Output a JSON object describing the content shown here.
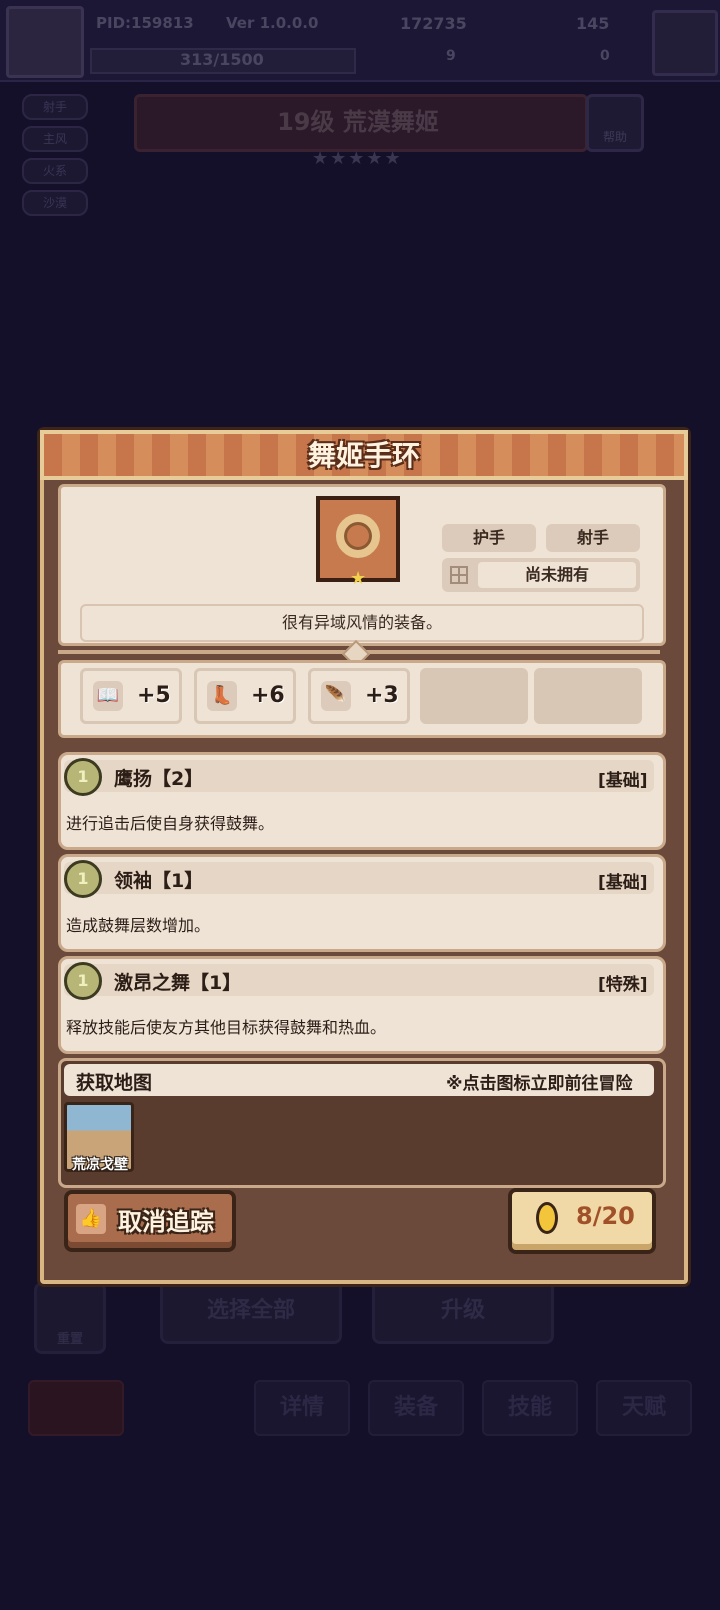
{
  "background": {
    "pid": "PID:159813",
    "version": "Ver 1.0.0.0",
    "coins": "172735",
    "gems": "145",
    "exp": "313/1500",
    "res_a": "9",
    "res_b": "0",
    "side_tags": [
      "射手",
      "主风",
      "火系",
      "沙漠"
    ],
    "hero_title": "19级 荒漠舞姬",
    "help_label": "帮助",
    "stars": "★★★★★",
    "select_all": "选择全部",
    "upgrade": "升级",
    "reset_label": "重置",
    "tabs": [
      "详情",
      "装备",
      "技能",
      "天赋"
    ]
  },
  "item": {
    "name": "舞姬手环",
    "tags": [
      "护手",
      "射手"
    ],
    "ownership": "尚未拥有",
    "description": "很有异域风情的装备。",
    "stats": [
      {
        "icon": "book-icon",
        "value": "+5"
      },
      {
        "icon": "boot-icon",
        "value": "+6"
      },
      {
        "icon": "wing-icon",
        "value": "+3"
      }
    ]
  },
  "skills": [
    {
      "name": "鹰扬【2】",
      "type": "[基础]",
      "desc": "进行追击后使自身获得鼓舞。"
    },
    {
      "name": "领袖【1】",
      "type": "[基础]",
      "desc": "造成鼓舞层数增加。"
    },
    {
      "name": "激昂之舞【1】",
      "type": "[特殊]",
      "desc": "释放技能后使友方其他目标获得鼓舞和热血。"
    }
  ],
  "maps": {
    "title": "获取地图",
    "hint": "※点击图标立即前往冒险",
    "items": [
      {
        "label": "荒凉戈壁"
      }
    ]
  },
  "actions": {
    "untrack": "取消追踪",
    "count": "8/20"
  },
  "colors": {
    "dialog_bg": "#6b4a3b",
    "panel_bg": "#efe3d6",
    "header_orange": "#c6764a",
    "count_text": "#a0512a"
  }
}
